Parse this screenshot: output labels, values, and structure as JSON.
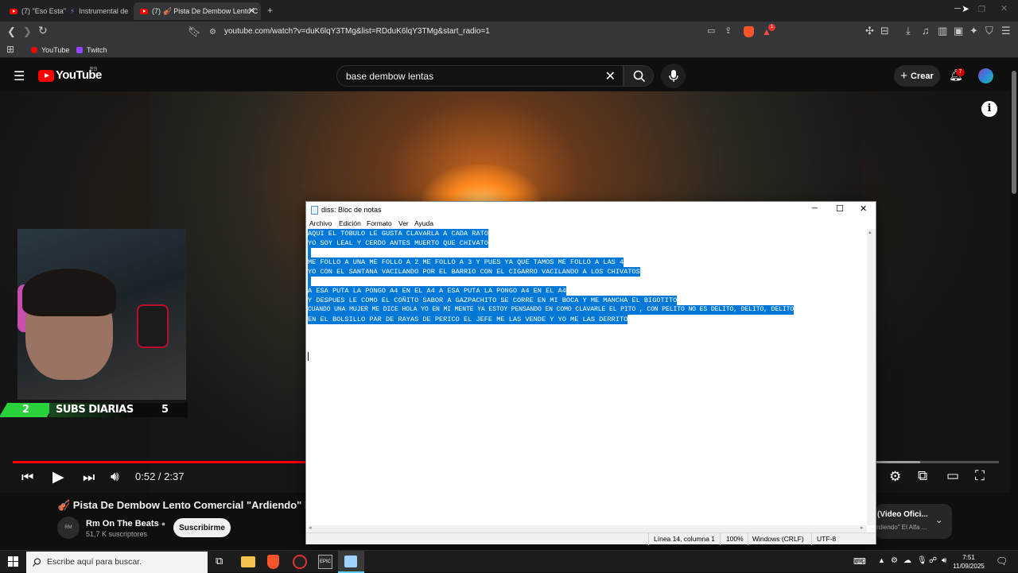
{
  "browser": {
    "tabs": [
      {
        "label": "(7) \"Eso Esta\"",
        "label2": "Instrumental de"
      },
      {
        "label": "(7) 🎻 Pista De Dembow Lento C"
      }
    ],
    "new_tab_glyph": "+",
    "url": "youtube.com/watch?v=duK6lqY3TMg&list=RDduK6lqY3TMg&start_radio=1",
    "bookmarks": [
      {
        "label": "YouTube"
      },
      {
        "label": "Twitch"
      }
    ],
    "shield_badge": "",
    "alert_badge": "1"
  },
  "youtube": {
    "logo_text": "YouTube",
    "region": "ES",
    "search_value": "base dembow lentas",
    "create_label": "Crear",
    "notif_count": "7"
  },
  "player": {
    "subs_left": "2",
    "subs_label": "SUBS DIARIAS",
    "subs_right": "5",
    "time_current": "0:52",
    "time_sep": " / ",
    "time_total": "2:37",
    "progress_played": 0.3,
    "progress_buffered_end": 0.92
  },
  "video": {
    "title": "🎻 Pista De Dembow Lento Comercial \"Ardiendo\" El A",
    "channel": "Rm On The Beats",
    "subscribers": "51,7 K suscriptores",
    "subscribe_label": "Suscribirme",
    "avatar_text": "RM",
    "next_card_title": "(Video Ofici...",
    "next_card_sub": "rdiendo\" El Alfa ..."
  },
  "notepad": {
    "title": "diss: Bloc de notas",
    "menu": [
      "Archivo",
      "Edición",
      "Formato",
      "Ver",
      "Ayuda"
    ],
    "lines": [
      "AQUI EL TOBULO LE GUSTA CLAVARLA A CADA RATO",
      "YO SOY LEAL Y CERDO ANTES MUERTO QUE CHIVATO",
      "",
      "ME FOLLO A UNA ME FOLLO A 2 ME FOLLO A 3 Y PUES YA QUE TAMOS ME FOLLO A LAS 4",
      "YO CON EL SANTANA VACILANDO POR EL BARRIO CON EL CIGARRO VACILANDO A LOS CHIVATOS",
      "",
      "A ESA PUTA LA PONGO A4 EN EL A4 A ESA PUTA LA PONGO A4 EN EL A4",
      "Y DESPUES LE COMO EL COÑITO SABOR A GAZPACHITO SE CORRE EN MI BOCA Y ME MANCHA EL BIGOTITO",
      "CUANDO UNA MUJER ME DICE HOLA YO EN MI MENTE YA ESTOY PENSANDO EN COMO CLAVARLE EL PITO , CON PELITO NO ES DELITO, DELITO, DELITO",
      "EN EL BOLSILLO PAR DE RAYAS DE PERICO EL JEFE ME LAS VENDE Y YO ME LAS DERRITO"
    ],
    "status_position": "Línea 14, columna 1",
    "status_zoom": "100%",
    "status_eol": "Windows (CRLF)",
    "status_encoding": "UTF-8"
  },
  "taskbar": {
    "search_placeholder": "Escribe aquí para buscar.",
    "time": "7:51",
    "date": "11/09/2025"
  },
  "colors": {
    "selection": "#0078d7",
    "youtube_red": "#ff0000",
    "subs_green": "#29d13a"
  }
}
